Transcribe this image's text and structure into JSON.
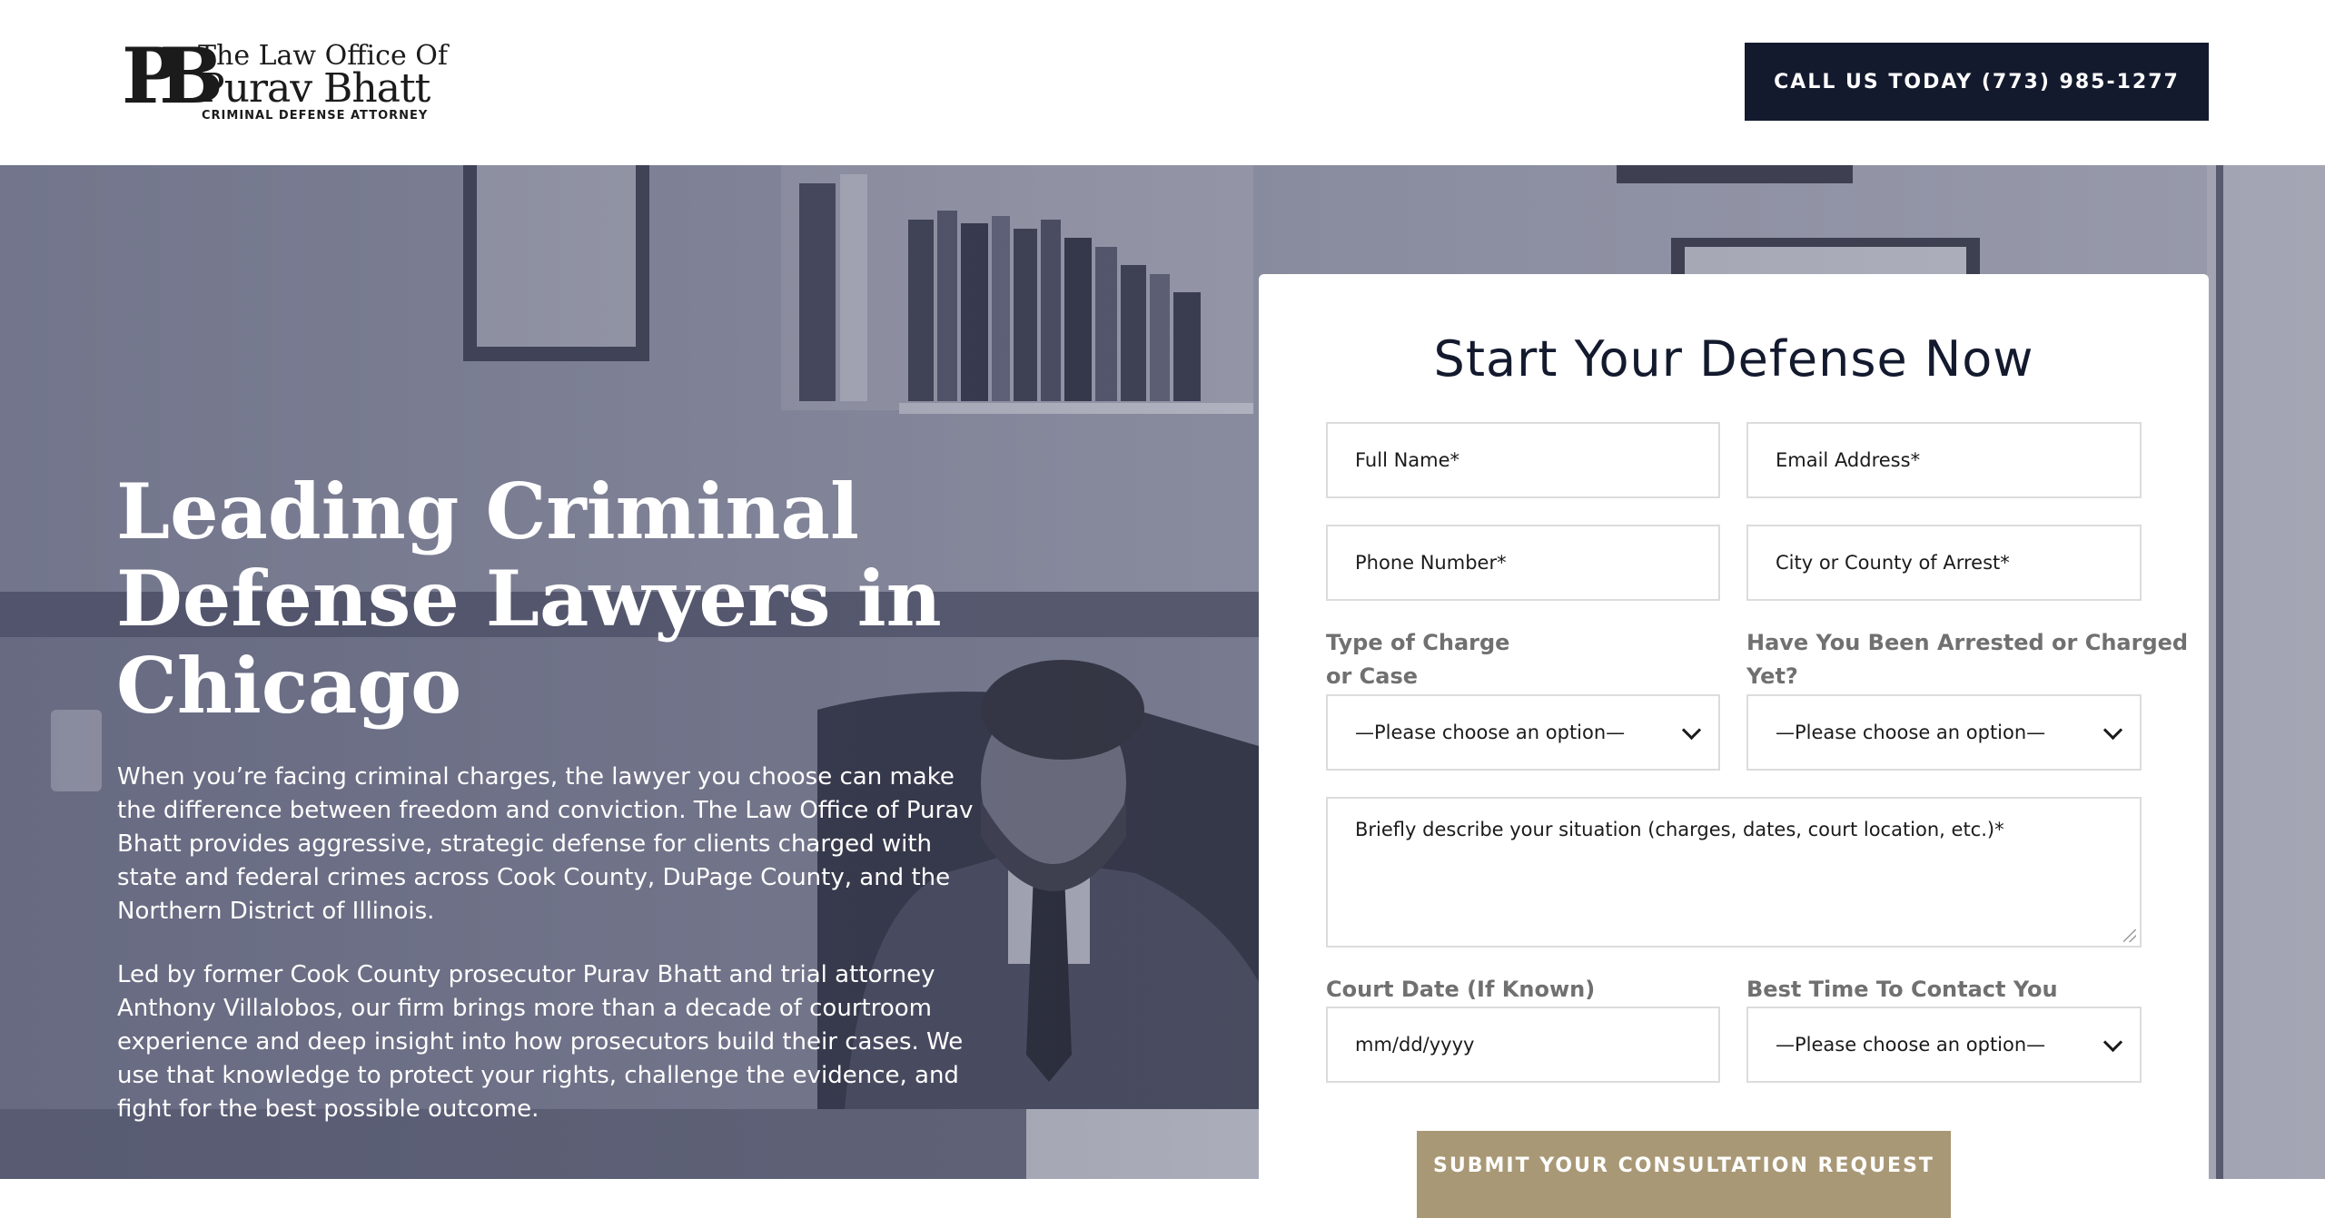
{
  "header": {
    "logo": {
      "monogram": "PB",
      "line1": "The Law Office Of",
      "line2": "Purav Bhatt",
      "line3": "CRIMINAL DEFENSE ATTORNEY"
    },
    "call_button": "CALL US TODAY (773) 985-1277"
  },
  "hero": {
    "title": "Leading Criminal Defense Lawyers in Chicago",
    "paragraph1": "When you’re facing criminal charges, the lawyer you choose can make the difference between freedom and conviction. The Law Office of Purav Bhatt provides aggressive, strategic defense for clients charged with state and federal crimes across Cook County, DuPage County, and the Northern District of Illinois.",
    "paragraph2": "Led by former Cook County prosecutor Purav Bhatt and trial attorney Anthony Villalobos, our firm brings more than a decade of courtroom experience and deep insight into how prosecutors build their cases. We use that knowledge to protect your rights, challenge the evidence, and fight for the best possible outcome."
  },
  "form": {
    "title": "Start Your Defense Now",
    "full_name_placeholder": "Full Name*",
    "email_placeholder": "Email Address*",
    "phone_placeholder": "Phone Number*",
    "city_placeholder": "City or County of Arrest*",
    "charge_label_line1": "Type of Charge",
    "charge_label_line2": "or Case",
    "charge_selected": "—Please choose an option—",
    "arrested_label_line1": "Have You Been Arrested or Charged",
    "arrested_label_line2": "Yet?",
    "arrested_selected": "—Please choose an option—",
    "description_placeholder": "Briefly describe your situation (charges, dates, court location, etc.)*",
    "court_date_label": "Court Date (If Known)",
    "court_date_placeholder": "mm/dd/yyyy",
    "best_time_label": "Best Time To Contact You",
    "best_time_selected": "—Please choose an option—",
    "submit_label": "SUBMIT YOUR CONSULTATION REQUEST"
  },
  "colors": {
    "navy": "#141a2e",
    "gold": "#a99876",
    "label_gray": "#707070"
  }
}
